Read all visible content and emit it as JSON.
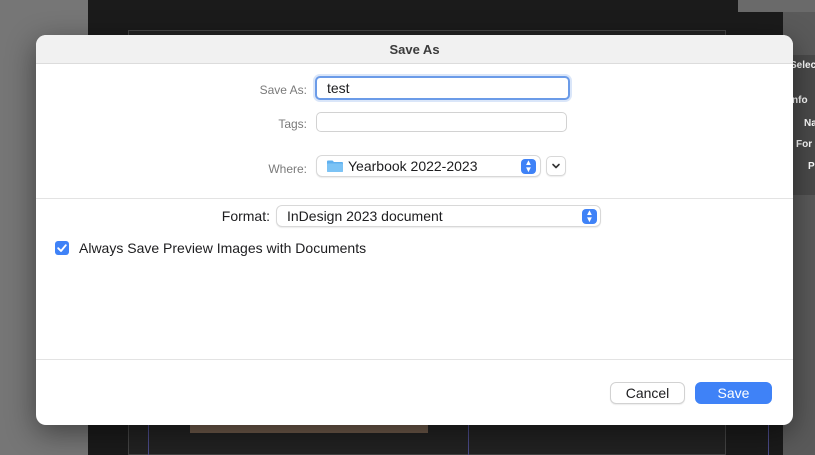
{
  "background": {
    "right_panel": [
      "Selec",
      "nfo",
      "Na",
      "For",
      "P"
    ]
  },
  "dialog": {
    "title": "Save As",
    "save_as_label": "Save As:",
    "save_as_value": "test",
    "tags_label": "Tags:",
    "tags_value": "",
    "where_label": "Where:",
    "where_value": "Yearbook 2022-2023",
    "format_label": "Format:",
    "format_value": "InDesign 2023 document",
    "checkbox_label": "Always Save Preview Images with Documents",
    "checkbox_checked": true,
    "cancel_label": "Cancel",
    "save_label": "Save"
  },
  "colors": {
    "accent": "#3f82f7",
    "folder": "#5fb0ef"
  }
}
